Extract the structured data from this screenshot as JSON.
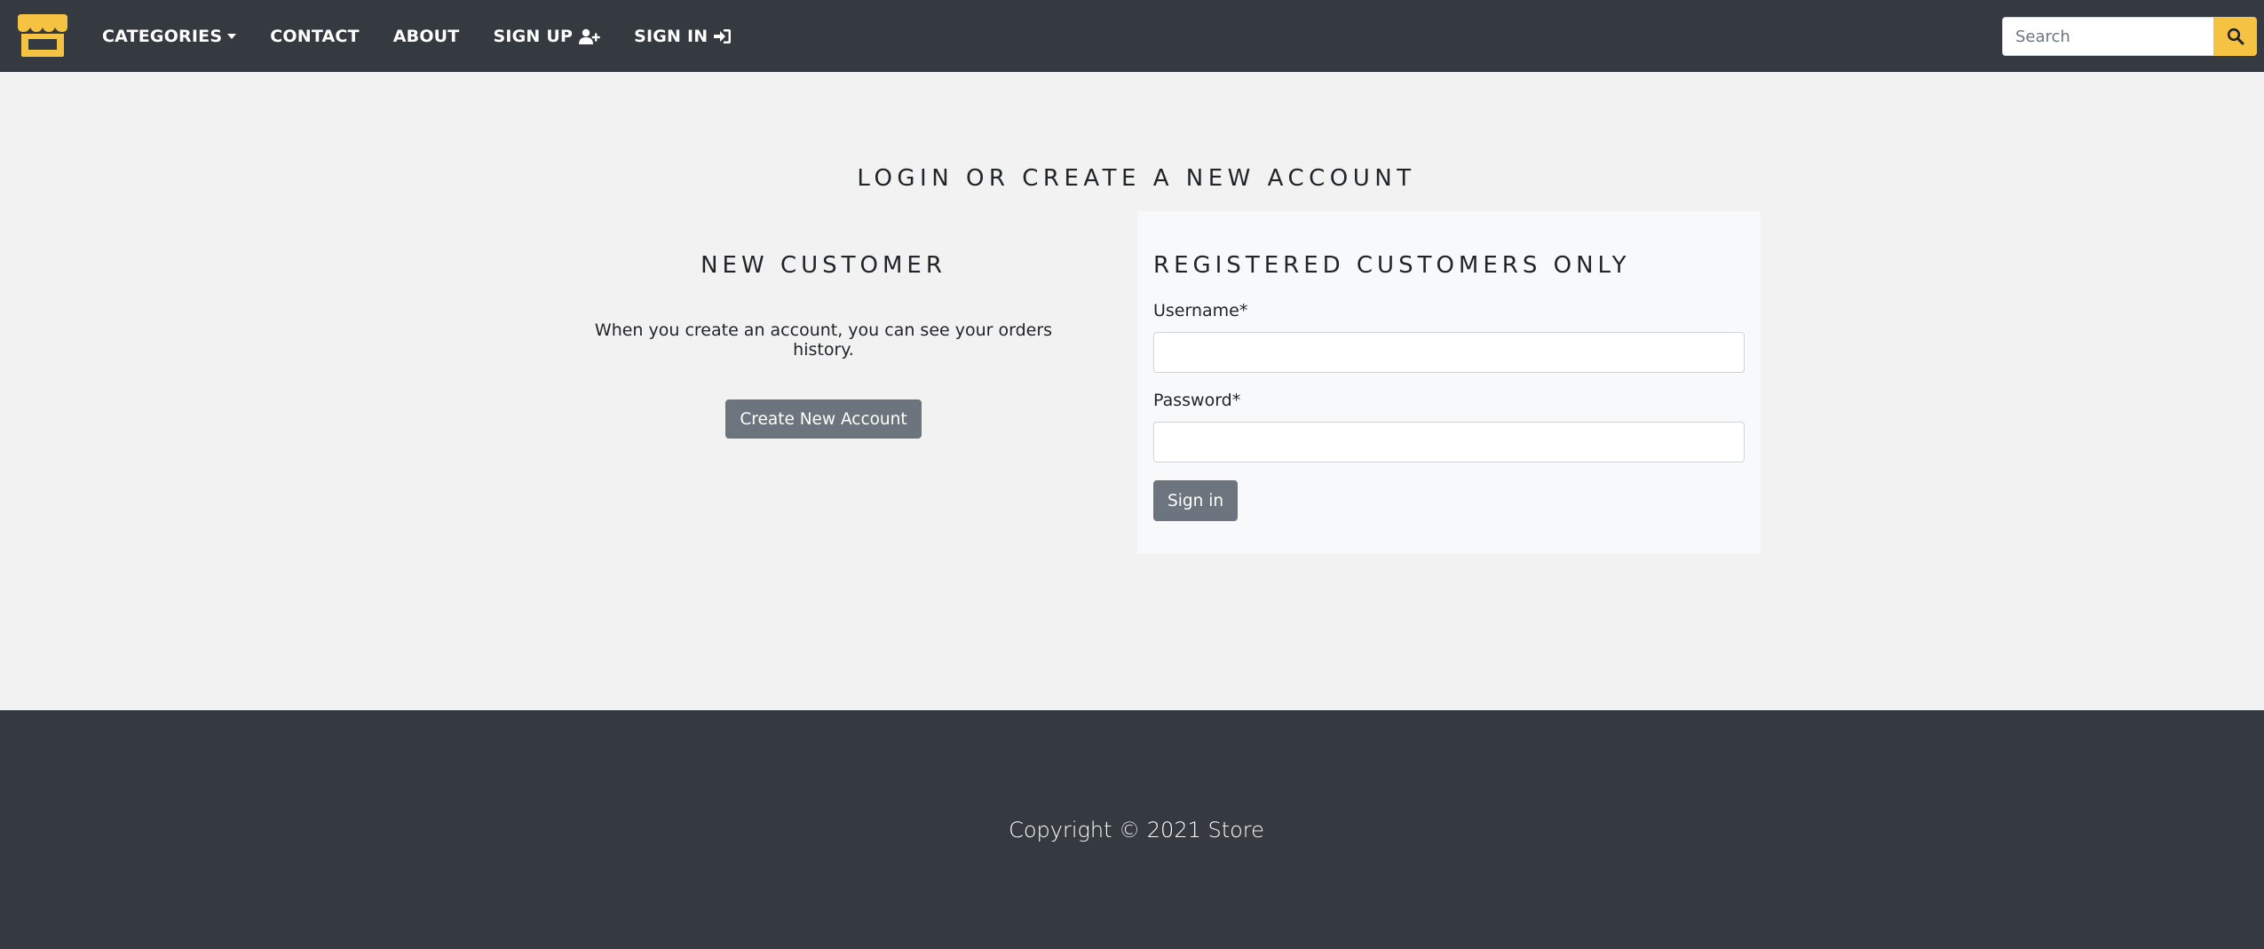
{
  "navbar": {
    "brand_icon": "store-icon",
    "accent_color": "#f5c242",
    "links": [
      {
        "label": "CATEGORIES",
        "has_dropdown": true
      },
      {
        "label": "CONTACT"
      },
      {
        "label": "ABOUT"
      },
      {
        "label": "SIGN UP",
        "icon": "user-plus-icon"
      },
      {
        "label": "SIGN IN",
        "icon": "sign-in-icon"
      }
    ],
    "search": {
      "placeholder": "Search",
      "value": "",
      "icon": "search-icon"
    }
  },
  "main": {
    "title": "LOGIN OR CREATE A NEW ACCOUNT",
    "new_customer": {
      "heading": "NEW CUSTOMER",
      "text": "When you create an account, you can see your orders history.",
      "button_label": "Create New Account"
    },
    "registered": {
      "heading": "REGISTERED CUSTOMERS ONLY",
      "username_label": "Username*",
      "username_value": "",
      "password_label": "Password*",
      "password_value": "",
      "button_label": "Sign in"
    }
  },
  "footer": {
    "copyright": "Copyright © 2021 Store"
  }
}
